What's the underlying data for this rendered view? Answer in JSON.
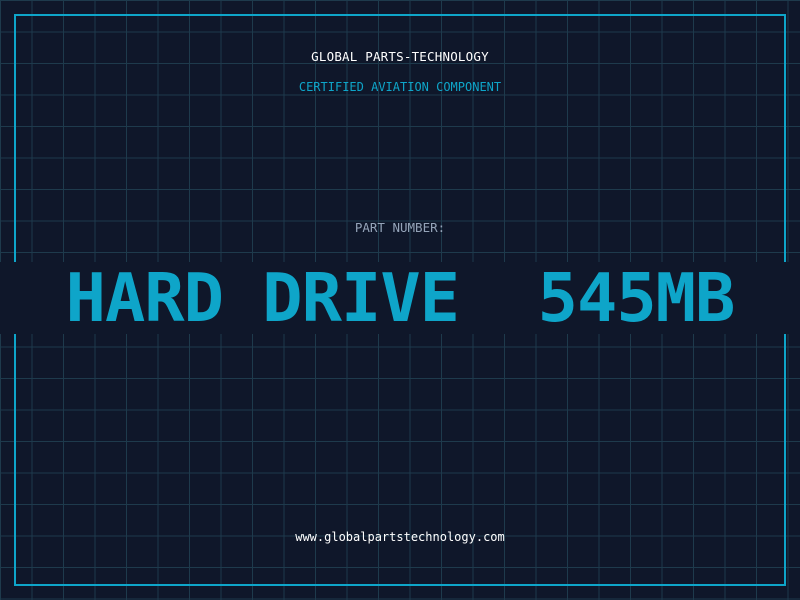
{
  "header": {
    "brand": "GLOBAL PARTS-TECHNOLOGY",
    "tagline": "CERTIFIED AVIATION COMPONENT"
  },
  "part": {
    "label": "PART NUMBER:",
    "value": "HARD DRIVE  545MB"
  },
  "footer": {
    "url": "www.globalpartstechnology.com"
  },
  "colors": {
    "background": "#0f172a",
    "grid": "#1e3a4c",
    "accent": "#0ea5c9",
    "text": "#ffffff",
    "muted": "#94a3b8"
  }
}
